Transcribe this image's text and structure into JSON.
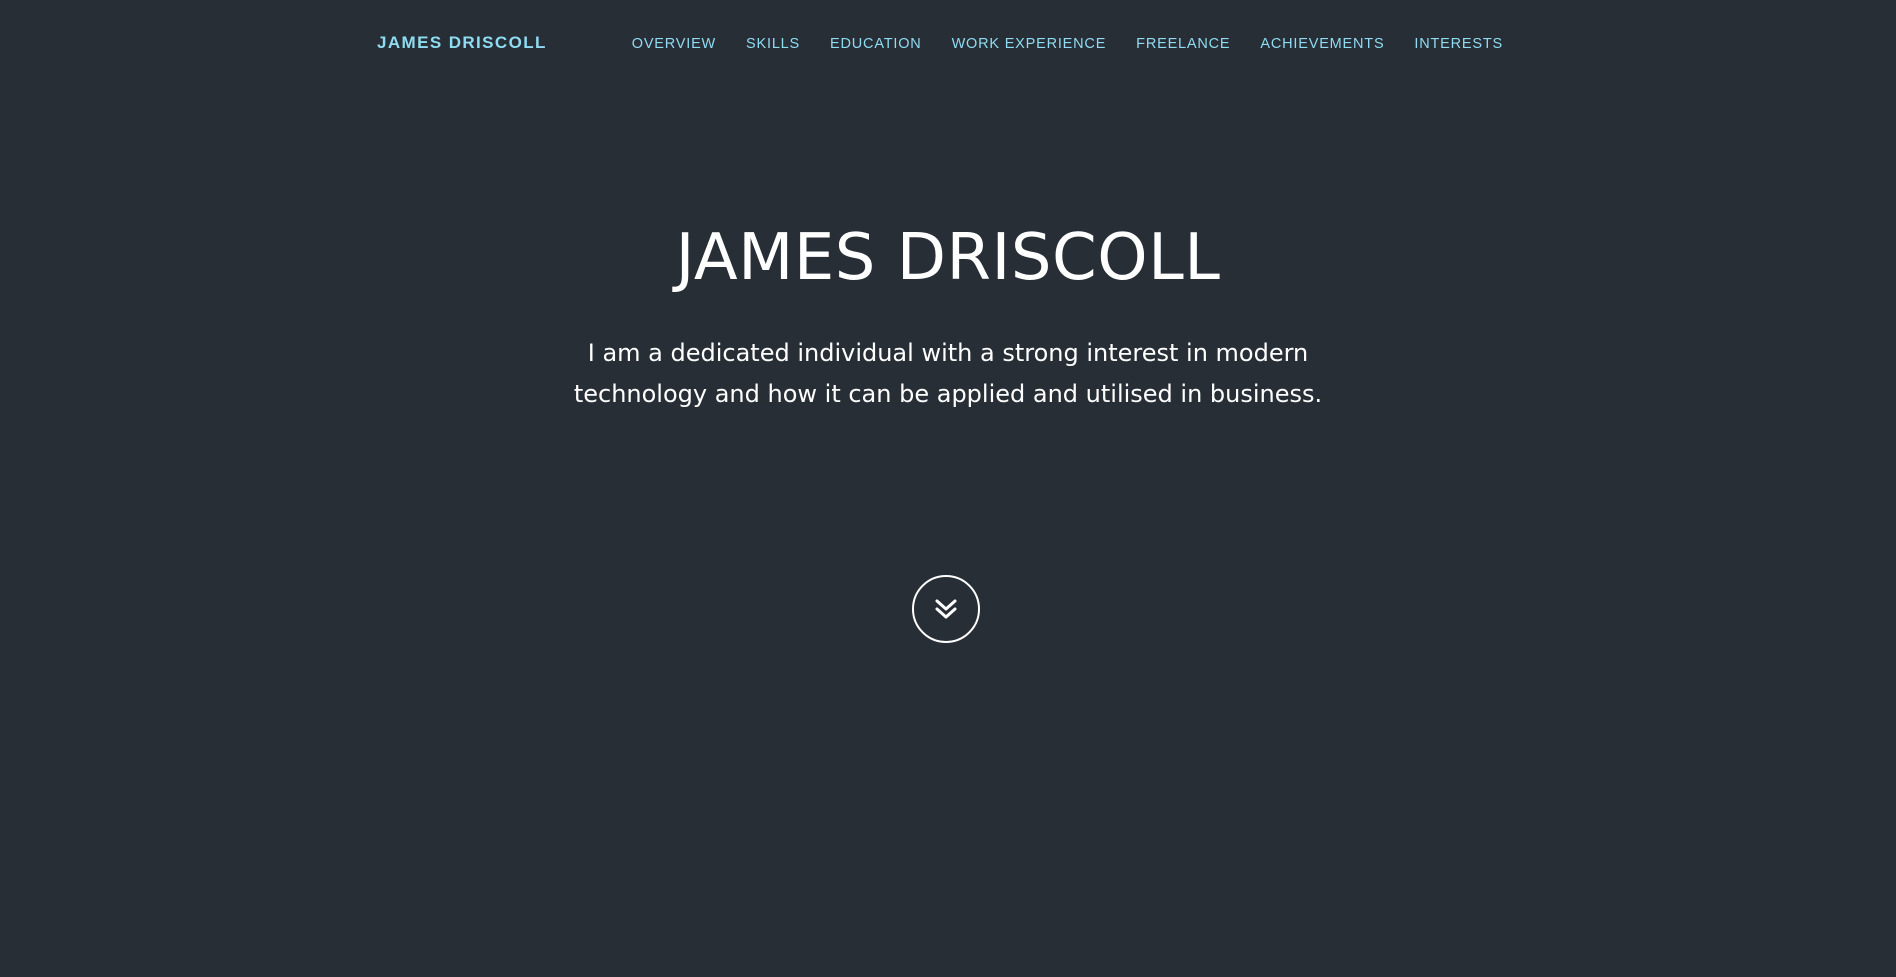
{
  "navbar": {
    "brand": "JAMES DRISCOLL",
    "links": [
      {
        "label": "OVERVIEW"
      },
      {
        "label": "SKILLS"
      },
      {
        "label": "EDUCATION"
      },
      {
        "label": "WORK EXPERIENCE"
      },
      {
        "label": "FREELANCE"
      },
      {
        "label": "ACHIEVEMENTS"
      },
      {
        "label": "INTERESTS"
      }
    ]
  },
  "hero": {
    "title": "JAMES DRISCOLL",
    "subtitle_line1": "I am a dedicated individual with a strong interest in modern",
    "subtitle_line2": "technology and how it can be applied and utilised in business.",
    "scroll_icon": "double-chevron-down-icon"
  },
  "colors": {
    "background": "#272e36",
    "accent": "#8fdcf2",
    "text": "#ffffff"
  }
}
